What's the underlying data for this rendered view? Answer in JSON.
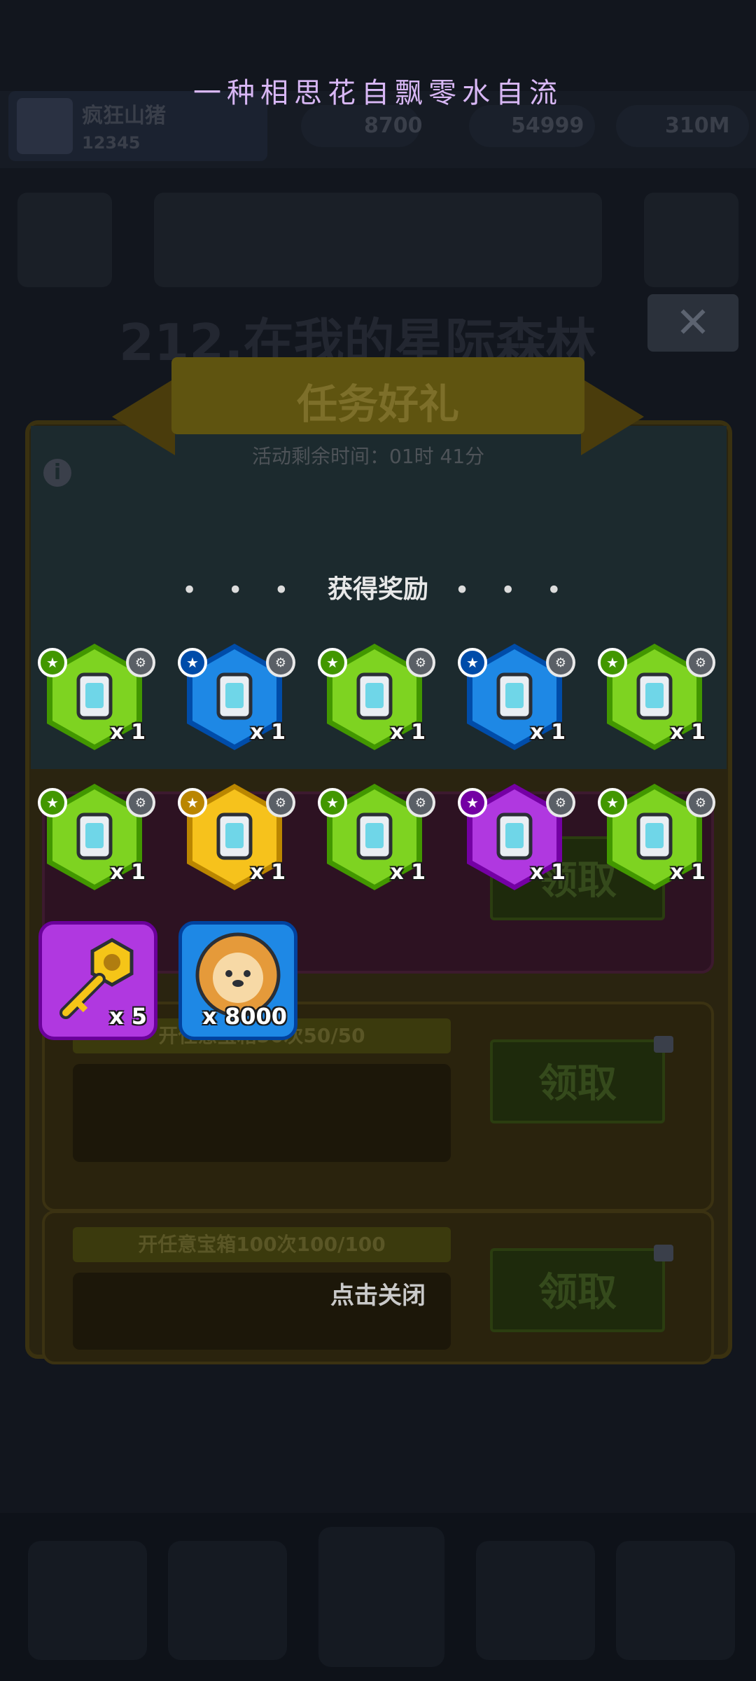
{
  "watermark": "一种相思花自飘零水自流",
  "background": {
    "player_name": "疯狂山猪",
    "player_sub": "12345",
    "res1": "8700",
    "res2": "54999",
    "res3": "310M",
    "event_title": "212.在我的星际森林",
    "ribbon_title": "任务好礼",
    "timer": "活动剩余时间：01时 41分",
    "task2_label": "开任意宝箱50次50/50",
    "task3_label": "开任意宝箱100次100/100",
    "claim_label": "领取",
    "close_icon": "close-icon"
  },
  "reward_header": {
    "dots_left": "• • •",
    "title": "获得奖励",
    "dots_right": "• • •"
  },
  "rewards": [
    {
      "color": "#7ed321",
      "count": "x 1",
      "icon": "canister-icon"
    },
    {
      "color": "#1e88e5",
      "count": "x 1",
      "icon": "armor-icon"
    },
    {
      "color": "#7ed321",
      "count": "x 1",
      "icon": "robot-arm-icon"
    },
    {
      "color": "#1e88e5",
      "count": "x 1",
      "icon": "cannon-icon"
    },
    {
      "color": "#7ed321",
      "count": "x 1",
      "icon": "armor-icon"
    },
    {
      "color": "#7ed321",
      "count": "x 1",
      "icon": "robot-body-icon"
    },
    {
      "color": "#f6c21c",
      "count": "x 1",
      "icon": "bracket-icon"
    },
    {
      "color": "#7ed321",
      "count": "x 1",
      "icon": "shield-core-icon"
    },
    {
      "color": "#b038e0",
      "count": "x 1",
      "icon": "turret-icon"
    },
    {
      "color": "#7ed321",
      "count": "x 1",
      "icon": "drone-icon"
    }
  ],
  "extra_rewards": [
    {
      "color": "#b038e0",
      "count": "x 5",
      "icon": "key-icon"
    },
    {
      "color": "#1e88e5",
      "count": "x 8000",
      "icon": "coin-icon"
    }
  ],
  "close_hint": "点击关闭"
}
